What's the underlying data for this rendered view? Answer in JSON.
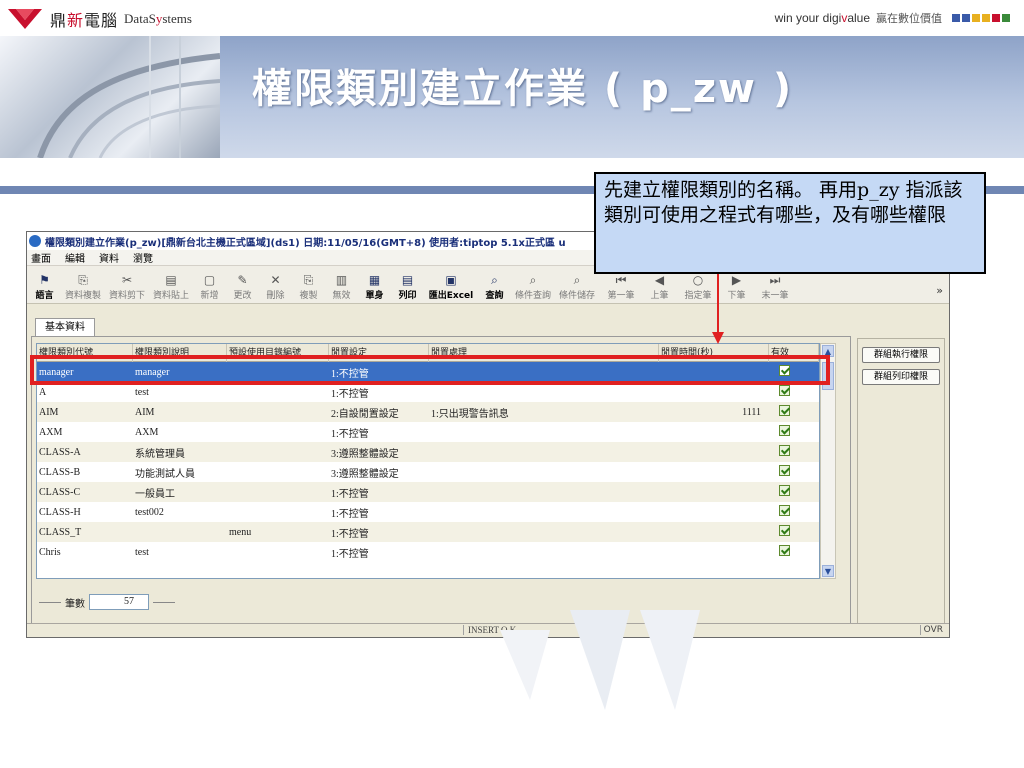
{
  "brand": {
    "name_cn_prefix": "鼎",
    "name_cn_red": "新",
    "name_cn_suffix": "電腦",
    "name_en_a": "DataS",
    "name_en_red": "y",
    "name_en_b": "stems",
    "slogan_en_a": "win your digi",
    "slogan_en_red": "v",
    "slogan_en_b": "alue",
    "slogan_cn": "贏在數位價值",
    "square_colors": [
      "#3a5aa8",
      "#3a5aa8",
      "#e8b020",
      "#e8b020",
      "#c8102e",
      "#3a8a3a"
    ]
  },
  "slide": {
    "title": "權限類別建立作業 ( p_zw )"
  },
  "window": {
    "title": "權限類別建立作業(p_zw)[鼎新台北主機正式區域](ds1)  日期:11/05/16(GMT+8)  使用者:tiptop 5.1x正式區 u"
  },
  "menu": [
    "畫面",
    "編輯",
    "資料",
    "瀏覽"
  ],
  "toolbar": [
    {
      "icon": "⚑",
      "label": "語言",
      "enabled": true
    },
    {
      "icon": "⎘",
      "label": "資料複製",
      "enabled": false
    },
    {
      "icon": "✂",
      "label": "資料剪下",
      "enabled": false
    },
    {
      "icon": "▤",
      "label": "資料貼上",
      "enabled": false
    },
    {
      "icon": "▢",
      "label": "新增",
      "enabled": false
    },
    {
      "icon": "✎",
      "label": "更改",
      "enabled": false
    },
    {
      "icon": "✕",
      "label": "刪除",
      "enabled": false
    },
    {
      "icon": "⎘",
      "label": "複製",
      "enabled": false
    },
    {
      "icon": "▥",
      "label": "無效",
      "enabled": false
    },
    {
      "icon": "▦",
      "label": "單身",
      "enabled": true
    },
    {
      "icon": "▤",
      "label": "列印",
      "enabled": true
    },
    {
      "icon": "▣",
      "label": "匯出Excel",
      "enabled": true
    },
    {
      "icon": "⌕",
      "label": "查詢",
      "enabled": true
    },
    {
      "icon": "⌕",
      "label": "條件查詢",
      "enabled": false
    },
    {
      "icon": "⌕",
      "label": "條件儲存",
      "enabled": false
    },
    {
      "icon": "⏮",
      "label": "第一筆",
      "enabled": false
    },
    {
      "icon": "◀",
      "label": "上筆",
      "enabled": false
    },
    {
      "icon": "○",
      "label": "指定筆",
      "enabled": false
    },
    {
      "icon": "▶",
      "label": "下筆",
      "enabled": false
    },
    {
      "icon": "⏭",
      "label": "末一筆",
      "enabled": false
    }
  ],
  "toolbar_more": "»",
  "tab": {
    "label": "基本資料"
  },
  "grid": {
    "columns": [
      "權限類別代號",
      "權限類別說明",
      "預設使用目錄編號",
      "閒置設定",
      "閒置處理",
      "閒置時間(秒)",
      "有效"
    ],
    "rows": [
      {
        "code": "manager",
        "desc": "manager",
        "menu": "",
        "idle": "1:不控管",
        "action": "",
        "secs": "",
        "valid": true,
        "selected": true
      },
      {
        "code": "A",
        "desc": "test",
        "menu": "",
        "idle": "1:不控管",
        "action": "",
        "secs": "",
        "valid": true
      },
      {
        "code": "AIM",
        "desc": "AIM",
        "menu": "",
        "idle": "2:自設閒置設定",
        "action": "1:只出現警告訊息",
        "secs": "1111",
        "valid": true
      },
      {
        "code": "AXM",
        "desc": "AXM",
        "menu": "",
        "idle": "1:不控管",
        "action": "",
        "secs": "",
        "valid": true
      },
      {
        "code": "CLASS-A",
        "desc": "系統管理員",
        "menu": "",
        "idle": "3:遵照整體設定",
        "action": "",
        "secs": "",
        "valid": true
      },
      {
        "code": "CLASS-B",
        "desc": "功能測試人員",
        "menu": "",
        "idle": "3:遵照整體設定",
        "action": "",
        "secs": "",
        "valid": true
      },
      {
        "code": "CLASS-C",
        "desc": "一般員工",
        "menu": "",
        "idle": "1:不控管",
        "action": "",
        "secs": "",
        "valid": true
      },
      {
        "code": "CLASS-H",
        "desc": "test002",
        "menu": "",
        "idle": "1:不控管",
        "action": "",
        "secs": "",
        "valid": true
      },
      {
        "code": "CLASS_T",
        "desc": "",
        "menu": "menu",
        "idle": "1:不控管",
        "action": "",
        "secs": "",
        "valid": true
      },
      {
        "code": "Chris",
        "desc": "test",
        "menu": "",
        "idle": "1:不控管",
        "action": "",
        "secs": "",
        "valid": true
      }
    ]
  },
  "side_buttons": [
    "群組執行權限",
    "群組列印權限"
  ],
  "count": {
    "label": "筆數",
    "value": "57"
  },
  "status": {
    "mode": "INSERT O.K",
    "ovr": "OVR"
  },
  "callout": {
    "text": "先建立權限類別的名稱。 再用p_zy 指派該類別可使用之程式有哪些，及有哪些權限"
  },
  "colors": {
    "accent_red": "#c8102e",
    "highlight_red": "#e02020",
    "selected_row": "#3a6fc4",
    "callout_bg": "#c5d9f5"
  }
}
